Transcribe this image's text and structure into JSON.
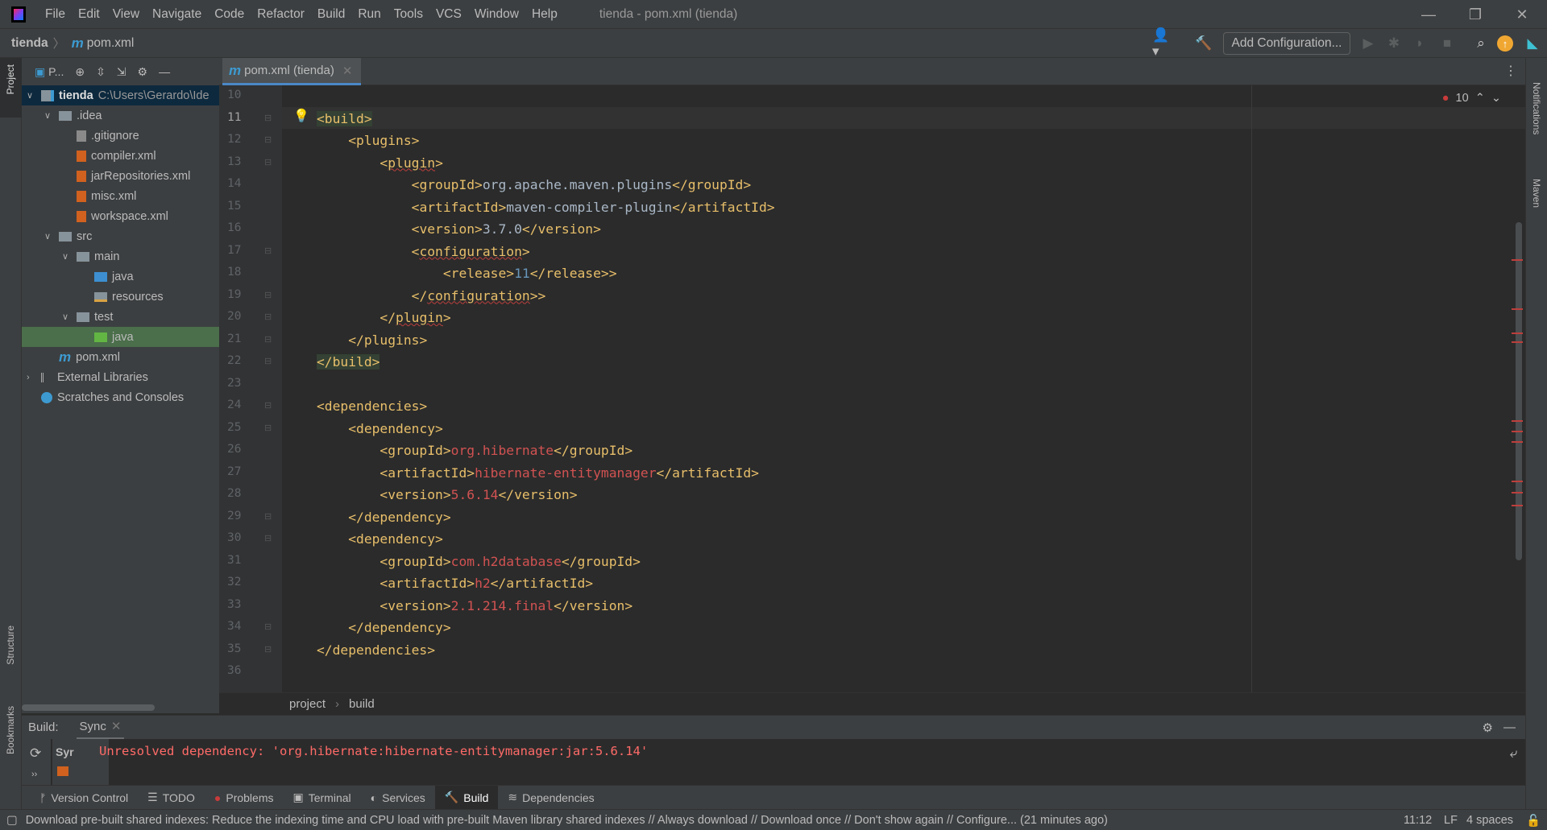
{
  "titlebar": {
    "menu": [
      "File",
      "Edit",
      "View",
      "Navigate",
      "Code",
      "Refactor",
      "Build",
      "Run",
      "Tools",
      "VCS",
      "Window",
      "Help"
    ],
    "title": "tienda - pom.xml (tienda)"
  },
  "navbar": {
    "project": "tienda",
    "file": "pom.xml",
    "add_configuration": "Add Configuration..."
  },
  "left_stripe": {
    "project": "Project",
    "structure": "Structure",
    "bookmarks": "Bookmarks"
  },
  "right_stripe": {
    "notifications": "Notifications",
    "maven": "Maven"
  },
  "project_panel": {
    "title": "P...",
    "tree": [
      {
        "label": "tienda",
        "extra": "C:\\Users\\Gerardo\\Ide",
        "depth": 0,
        "arrow": "open",
        "icon": "module-folder",
        "bold": true
      },
      {
        "label": ".idea",
        "depth": 1,
        "arrow": "open",
        "icon": "folder"
      },
      {
        "label": ".gitignore",
        "depth": 2,
        "icon": "gitignore-file"
      },
      {
        "label": "compiler.xml",
        "depth": 2,
        "icon": "xml-file"
      },
      {
        "label": "jarRepositories.xml",
        "depth": 2,
        "icon": "xml-file"
      },
      {
        "label": "misc.xml",
        "depth": 2,
        "icon": "xml-file"
      },
      {
        "label": "workspace.xml",
        "depth": 2,
        "icon": "xml-file"
      },
      {
        "label": "src",
        "depth": 1,
        "arrow": "open",
        "icon": "folder"
      },
      {
        "label": "main",
        "depth": 2,
        "arrow": "open",
        "icon": "folder"
      },
      {
        "label": "java",
        "depth": 3,
        "icon": "source-folder"
      },
      {
        "label": "resources",
        "depth": 3,
        "icon": "resources-folder"
      },
      {
        "label": "test",
        "depth": 2,
        "arrow": "open",
        "icon": "folder"
      },
      {
        "label": "java",
        "depth": 3,
        "icon": "test-folder",
        "selected": true
      },
      {
        "label": "pom.xml",
        "depth": 1,
        "icon": "maven-file"
      },
      {
        "label": "External Libraries",
        "depth": 0,
        "arrow": "closed",
        "icon": "library"
      },
      {
        "label": "Scratches and Consoles",
        "depth": 0,
        "icon": "scratches"
      }
    ]
  },
  "editor": {
    "tab": "pom.xml (tienda)",
    "error_count": "10",
    "lines": [
      {
        "n": "10",
        "t": []
      },
      {
        "n": "11",
        "t": [
          [
            "tag hl",
            "<build>"
          ]
        ]
      },
      {
        "n": "12",
        "t": [
          [
            "txt",
            "    "
          ],
          [
            "tag",
            "<plugins>"
          ]
        ]
      },
      {
        "n": "13",
        "t": [
          [
            "txt",
            "        "
          ],
          [
            "tag",
            "<"
          ],
          [
            "tag und",
            "plugin"
          ],
          [
            "tag",
            ">"
          ]
        ]
      },
      {
        "n": "14",
        "t": [
          [
            "txt",
            "            "
          ],
          [
            "tag",
            "<groupId>"
          ],
          [
            "txt",
            "org.apache.maven.plugins"
          ],
          [
            "tag",
            "</groupId>"
          ]
        ]
      },
      {
        "n": "15",
        "t": [
          [
            "txt",
            "            "
          ],
          [
            "tag",
            "<artifactId>"
          ],
          [
            "txt",
            "maven-compiler-plugin"
          ],
          [
            "tag",
            "</artifactId>"
          ]
        ]
      },
      {
        "n": "16",
        "t": [
          [
            "txt",
            "            "
          ],
          [
            "tag",
            "<version>"
          ],
          [
            "txt",
            "3.7.0"
          ],
          [
            "tag",
            "</version>"
          ]
        ]
      },
      {
        "n": "17",
        "t": [
          [
            "txt",
            "            "
          ],
          [
            "tag",
            "<"
          ],
          [
            "tag und",
            "configuration"
          ],
          [
            "tag",
            ">"
          ]
        ]
      },
      {
        "n": "18",
        "t": [
          [
            "txt",
            "                "
          ],
          [
            "tag",
            "<release>"
          ],
          [
            "num",
            "11"
          ],
          [
            "tag",
            "</release>>"
          ]
        ]
      },
      {
        "n": "19",
        "t": [
          [
            "txt",
            "            "
          ],
          [
            "tag",
            "</"
          ],
          [
            "tag und",
            "configuration"
          ],
          [
            "tag",
            ">>"
          ]
        ]
      },
      {
        "n": "20",
        "t": [
          [
            "txt",
            "        "
          ],
          [
            "tag",
            "</"
          ],
          [
            "tag und",
            "plugin"
          ],
          [
            "tag",
            ">"
          ]
        ]
      },
      {
        "n": "21",
        "t": [
          [
            "txt",
            "    "
          ],
          [
            "tag",
            "</plugins>"
          ]
        ]
      },
      {
        "n": "22",
        "t": [
          [
            "tag hl",
            "</build>"
          ]
        ]
      },
      {
        "n": "23",
        "t": []
      },
      {
        "n": "24",
        "t": [
          [
            "tag",
            "<dependencies>"
          ]
        ]
      },
      {
        "n": "25",
        "t": [
          [
            "txt",
            "    "
          ],
          [
            "tag",
            "<dependency>"
          ]
        ]
      },
      {
        "n": "26",
        "t": [
          [
            "txt",
            "        "
          ],
          [
            "tag",
            "<groupId>"
          ],
          [
            "err",
            "org.hibernate"
          ],
          [
            "tag",
            "</groupId>"
          ]
        ]
      },
      {
        "n": "27",
        "t": [
          [
            "txt",
            "        "
          ],
          [
            "tag",
            "<artifactId>"
          ],
          [
            "err",
            "hibernate-entitymanager"
          ],
          [
            "tag",
            "</artifactId>"
          ]
        ]
      },
      {
        "n": "28",
        "t": [
          [
            "txt",
            "        "
          ],
          [
            "tag",
            "<version>"
          ],
          [
            "err",
            "5.6.14"
          ],
          [
            "tag",
            "</version>"
          ]
        ]
      },
      {
        "n": "29",
        "t": [
          [
            "txt",
            "    "
          ],
          [
            "tag",
            "</dependency>"
          ]
        ]
      },
      {
        "n": "30",
        "t": [
          [
            "txt",
            "    "
          ],
          [
            "tag",
            "<dependency>"
          ]
        ]
      },
      {
        "n": "31",
        "t": [
          [
            "txt",
            "        "
          ],
          [
            "tag",
            "<groupId>"
          ],
          [
            "err",
            "com.h2database"
          ],
          [
            "tag",
            "</groupId>"
          ]
        ]
      },
      {
        "n": "32",
        "t": [
          [
            "txt",
            "        "
          ],
          [
            "tag",
            "<artifactId>"
          ],
          [
            "err",
            "h2"
          ],
          [
            "tag",
            "</artifactId>"
          ]
        ]
      },
      {
        "n": "33",
        "t": [
          [
            "txt",
            "        "
          ],
          [
            "tag",
            "<version>"
          ],
          [
            "err",
            "2.1.214.final"
          ],
          [
            "tag",
            "</version>"
          ]
        ]
      },
      {
        "n": "34",
        "t": [
          [
            "txt",
            "    "
          ],
          [
            "tag",
            "</dependency>"
          ]
        ]
      },
      {
        "n": "35",
        "t": [
          [
            "tag",
            "</dependencies>"
          ]
        ]
      },
      {
        "n": "36",
        "t": []
      }
    ],
    "breadcrumb": [
      "project",
      "build"
    ]
  },
  "build_panel": {
    "label": "Build:",
    "tab": "Sync",
    "tree_item": "Syr",
    "message": "Unresolved dependency: 'org.hibernate:hibernate-entitymanager:jar:5.6.14'"
  },
  "tool_tabs": [
    "Version Control",
    "TODO",
    "Problems",
    "Terminal",
    "Services",
    "Build",
    "Dependencies"
  ],
  "status": {
    "message": "Download pre-built shared indexes: Reduce the indexing time and CPU load with pre-built Maven library shared indexes // Always download // Download once // Don't show again // Configure... (21 minutes ago)",
    "position": "11:12",
    "line_sep": "LF",
    "indent": "4 spaces"
  },
  "colors": {
    "tag": "#e8bf6a",
    "text": "#a9b7c6",
    "error": "#d25252",
    "accent": "#4a88c7"
  }
}
